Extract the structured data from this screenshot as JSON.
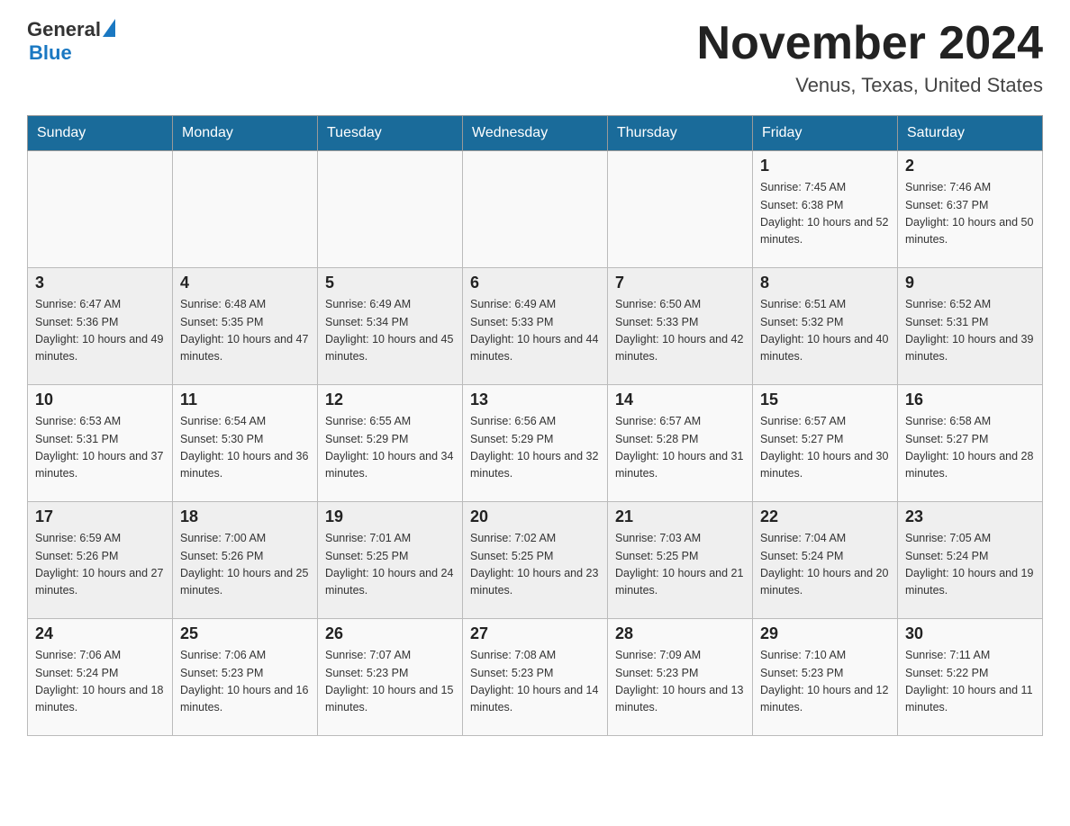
{
  "header": {
    "logo_text1": "General",
    "logo_text2": "Blue",
    "month_title": "November 2024",
    "location": "Venus, Texas, United States"
  },
  "days_of_week": [
    "Sunday",
    "Monday",
    "Tuesday",
    "Wednesday",
    "Thursday",
    "Friday",
    "Saturday"
  ],
  "weeks": [
    [
      {
        "day": "",
        "sunrise": "",
        "sunset": "",
        "daylight": ""
      },
      {
        "day": "",
        "sunrise": "",
        "sunset": "",
        "daylight": ""
      },
      {
        "day": "",
        "sunrise": "",
        "sunset": "",
        "daylight": ""
      },
      {
        "day": "",
        "sunrise": "",
        "sunset": "",
        "daylight": ""
      },
      {
        "day": "",
        "sunrise": "",
        "sunset": "",
        "daylight": ""
      },
      {
        "day": "1",
        "sunrise": "Sunrise: 7:45 AM",
        "sunset": "Sunset: 6:38 PM",
        "daylight": "Daylight: 10 hours and 52 minutes."
      },
      {
        "day": "2",
        "sunrise": "Sunrise: 7:46 AM",
        "sunset": "Sunset: 6:37 PM",
        "daylight": "Daylight: 10 hours and 50 minutes."
      }
    ],
    [
      {
        "day": "3",
        "sunrise": "Sunrise: 6:47 AM",
        "sunset": "Sunset: 5:36 PM",
        "daylight": "Daylight: 10 hours and 49 minutes."
      },
      {
        "day": "4",
        "sunrise": "Sunrise: 6:48 AM",
        "sunset": "Sunset: 5:35 PM",
        "daylight": "Daylight: 10 hours and 47 minutes."
      },
      {
        "day": "5",
        "sunrise": "Sunrise: 6:49 AM",
        "sunset": "Sunset: 5:34 PM",
        "daylight": "Daylight: 10 hours and 45 minutes."
      },
      {
        "day": "6",
        "sunrise": "Sunrise: 6:49 AM",
        "sunset": "Sunset: 5:33 PM",
        "daylight": "Daylight: 10 hours and 44 minutes."
      },
      {
        "day": "7",
        "sunrise": "Sunrise: 6:50 AM",
        "sunset": "Sunset: 5:33 PM",
        "daylight": "Daylight: 10 hours and 42 minutes."
      },
      {
        "day": "8",
        "sunrise": "Sunrise: 6:51 AM",
        "sunset": "Sunset: 5:32 PM",
        "daylight": "Daylight: 10 hours and 40 minutes."
      },
      {
        "day": "9",
        "sunrise": "Sunrise: 6:52 AM",
        "sunset": "Sunset: 5:31 PM",
        "daylight": "Daylight: 10 hours and 39 minutes."
      }
    ],
    [
      {
        "day": "10",
        "sunrise": "Sunrise: 6:53 AM",
        "sunset": "Sunset: 5:31 PM",
        "daylight": "Daylight: 10 hours and 37 minutes."
      },
      {
        "day": "11",
        "sunrise": "Sunrise: 6:54 AM",
        "sunset": "Sunset: 5:30 PM",
        "daylight": "Daylight: 10 hours and 36 minutes."
      },
      {
        "day": "12",
        "sunrise": "Sunrise: 6:55 AM",
        "sunset": "Sunset: 5:29 PM",
        "daylight": "Daylight: 10 hours and 34 minutes."
      },
      {
        "day": "13",
        "sunrise": "Sunrise: 6:56 AM",
        "sunset": "Sunset: 5:29 PM",
        "daylight": "Daylight: 10 hours and 32 minutes."
      },
      {
        "day": "14",
        "sunrise": "Sunrise: 6:57 AM",
        "sunset": "Sunset: 5:28 PM",
        "daylight": "Daylight: 10 hours and 31 minutes."
      },
      {
        "day": "15",
        "sunrise": "Sunrise: 6:57 AM",
        "sunset": "Sunset: 5:27 PM",
        "daylight": "Daylight: 10 hours and 30 minutes."
      },
      {
        "day": "16",
        "sunrise": "Sunrise: 6:58 AM",
        "sunset": "Sunset: 5:27 PM",
        "daylight": "Daylight: 10 hours and 28 minutes."
      }
    ],
    [
      {
        "day": "17",
        "sunrise": "Sunrise: 6:59 AM",
        "sunset": "Sunset: 5:26 PM",
        "daylight": "Daylight: 10 hours and 27 minutes."
      },
      {
        "day": "18",
        "sunrise": "Sunrise: 7:00 AM",
        "sunset": "Sunset: 5:26 PM",
        "daylight": "Daylight: 10 hours and 25 minutes."
      },
      {
        "day": "19",
        "sunrise": "Sunrise: 7:01 AM",
        "sunset": "Sunset: 5:25 PM",
        "daylight": "Daylight: 10 hours and 24 minutes."
      },
      {
        "day": "20",
        "sunrise": "Sunrise: 7:02 AM",
        "sunset": "Sunset: 5:25 PM",
        "daylight": "Daylight: 10 hours and 23 minutes."
      },
      {
        "day": "21",
        "sunrise": "Sunrise: 7:03 AM",
        "sunset": "Sunset: 5:25 PM",
        "daylight": "Daylight: 10 hours and 21 minutes."
      },
      {
        "day": "22",
        "sunrise": "Sunrise: 7:04 AM",
        "sunset": "Sunset: 5:24 PM",
        "daylight": "Daylight: 10 hours and 20 minutes."
      },
      {
        "day": "23",
        "sunrise": "Sunrise: 7:05 AM",
        "sunset": "Sunset: 5:24 PM",
        "daylight": "Daylight: 10 hours and 19 minutes."
      }
    ],
    [
      {
        "day": "24",
        "sunrise": "Sunrise: 7:06 AM",
        "sunset": "Sunset: 5:24 PM",
        "daylight": "Daylight: 10 hours and 18 minutes."
      },
      {
        "day": "25",
        "sunrise": "Sunrise: 7:06 AM",
        "sunset": "Sunset: 5:23 PM",
        "daylight": "Daylight: 10 hours and 16 minutes."
      },
      {
        "day": "26",
        "sunrise": "Sunrise: 7:07 AM",
        "sunset": "Sunset: 5:23 PM",
        "daylight": "Daylight: 10 hours and 15 minutes."
      },
      {
        "day": "27",
        "sunrise": "Sunrise: 7:08 AM",
        "sunset": "Sunset: 5:23 PM",
        "daylight": "Daylight: 10 hours and 14 minutes."
      },
      {
        "day": "28",
        "sunrise": "Sunrise: 7:09 AM",
        "sunset": "Sunset: 5:23 PM",
        "daylight": "Daylight: 10 hours and 13 minutes."
      },
      {
        "day": "29",
        "sunrise": "Sunrise: 7:10 AM",
        "sunset": "Sunset: 5:23 PM",
        "daylight": "Daylight: 10 hours and 12 minutes."
      },
      {
        "day": "30",
        "sunrise": "Sunrise: 7:11 AM",
        "sunset": "Sunset: 5:22 PM",
        "daylight": "Daylight: 10 hours and 11 minutes."
      }
    ]
  ]
}
